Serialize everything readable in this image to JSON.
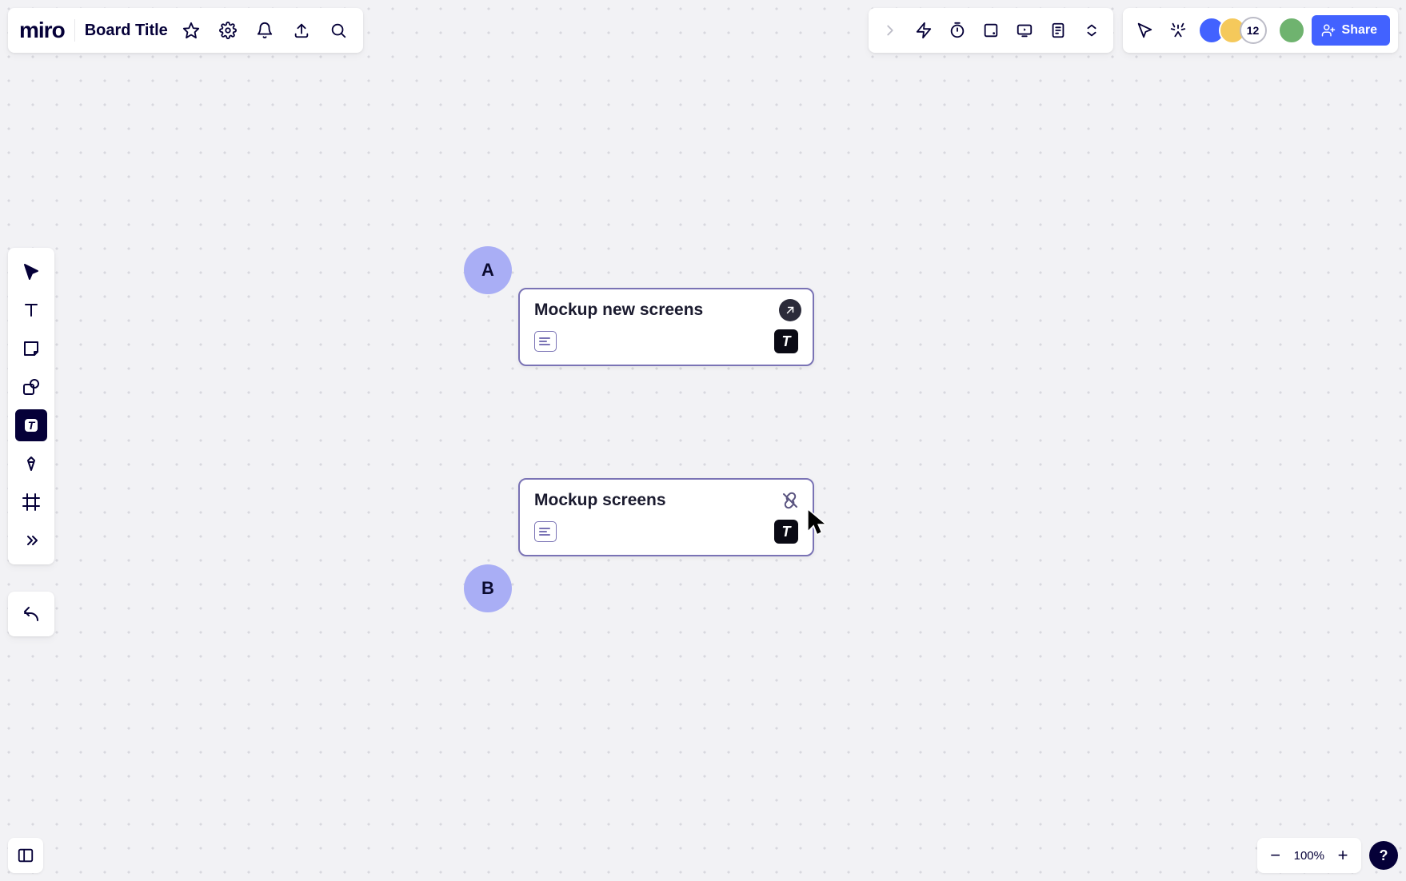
{
  "app": {
    "logo": "miro"
  },
  "header": {
    "board_title": "Board Title"
  },
  "collab": {
    "overflow_count": "12",
    "share_label": "Share"
  },
  "zoom": {
    "level": "100%",
    "help": "?"
  },
  "canvas": {
    "badges": {
      "a": "A",
      "b": "B"
    },
    "cards": [
      {
        "title": "Mockup new screens",
        "app_badge": "T"
      },
      {
        "title": "Mockup screens",
        "app_badge": "T"
      }
    ]
  }
}
